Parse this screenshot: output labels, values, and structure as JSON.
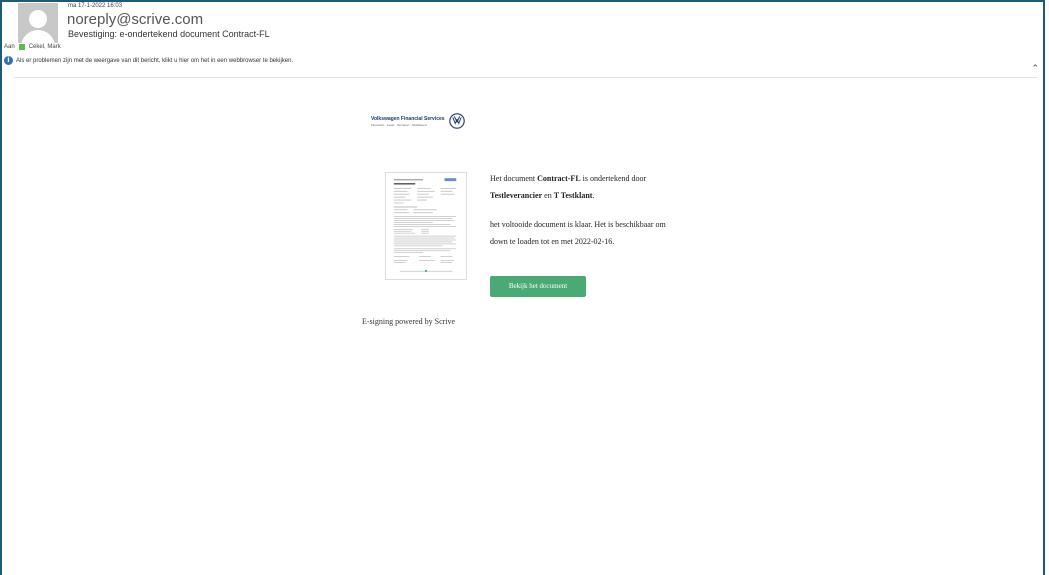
{
  "header": {
    "date": "ma 17-1-2022 16:03",
    "sender": "noreply@scrive.com",
    "subject": "Bevestiging: e-ondertekend document Contract-FL",
    "to_label": "Aan",
    "recipient": "Cekel, Mark",
    "info_notice": "Als er problemen zijn met de weergave van dit bericht, klikt u hier om het in een webbrowser te bekijken."
  },
  "logo": {
    "company": "Volkswagen Financial Services",
    "tagline": "Financiert · Least · Verzekert · Mobiliseert"
  },
  "message": {
    "p1_pre": "Het document ",
    "document_name": "Contract-FL",
    "p1_mid": " is ondertekend door ",
    "party1": "Testleverancier",
    "p1_and": " en ",
    "party2": "T Testklant",
    "p1_end": ".",
    "p2": "het voltooide document is klaar. Het is beschikbaar om down te loaden tot en met 2022-02-16."
  },
  "cta_label": "Bekijk het document",
  "footer": "E-signing powered by Scrive",
  "colors": {
    "frame": "#1f5a7a",
    "button": "#4aaa74",
    "presence": "#5bbd4f",
    "info": "#2b73b8",
    "brand": "#1a3a6e"
  }
}
